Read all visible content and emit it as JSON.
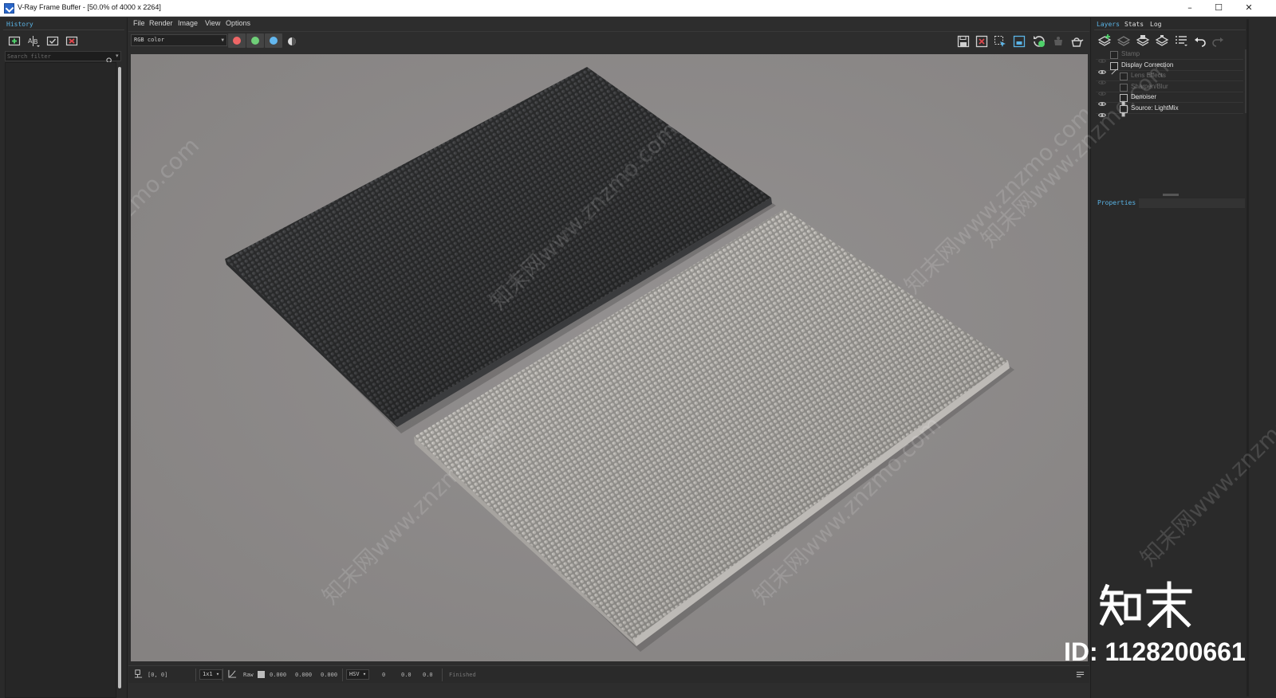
{
  "window": {
    "title": "V-Ray Frame Buffer - [50.0% of 4000 x 2264]",
    "controls": [
      "–",
      "☐",
      "✕"
    ]
  },
  "history": {
    "tab_label": "History",
    "search_placeholder": "Search filter",
    "tool_icons": [
      "save-to-history-icon",
      "ab-compare-icon",
      "load-history-icon",
      "delete-history-icon"
    ]
  },
  "menu": [
    "File",
    "Render",
    "Image",
    "View",
    "Options"
  ],
  "toolbar": {
    "channel": "RGB color",
    "channel_buttons": [
      {
        "name": "red-channel",
        "color": "#ee6666"
      },
      {
        "name": "green-channel",
        "color": "#6fcf78"
      },
      {
        "name": "blue-channel",
        "color": "#63b7ef"
      }
    ],
    "right_icons": [
      "save-image-icon",
      "clear-image-icon",
      "region-render-icon",
      "track-mouse-icon",
      "interactive-render-icon",
      "stop-render-icon",
      "render-teapot-icon"
    ]
  },
  "viewport": {
    "background": "#8e8b89",
    "objects": [
      "dark-bath-mat",
      "light-bath-mat"
    ]
  },
  "statusbar": {
    "coords": "[0, 0]",
    "zoom": "1x1",
    "mode": "Raw",
    "rgb_values": [
      "0.000",
      "0.000",
      "0.000"
    ],
    "color_space": "HSV",
    "hsv_values": [
      "0",
      "0.0",
      "0.0"
    ],
    "status": "Finished"
  },
  "right_panel": {
    "tabs": [
      "Layers",
      "Stats",
      "Log"
    ],
    "active_tab": "Layers",
    "layer_icons": [
      "create-layer-icon",
      "load-layer-icon",
      "save-layers-icon",
      "layer-presets-icon",
      "layer-list-icon",
      "undo-icon",
      "redo-icon"
    ],
    "layers": [
      {
        "label": "Stamp",
        "visible": false,
        "level": 0,
        "dim": true
      },
      {
        "label": "Display Correction",
        "visible": true,
        "level": 0,
        "dim": false
      },
      {
        "label": "Lens Effects",
        "visible": false,
        "level": 1,
        "dim": true
      },
      {
        "label": "Sharpen/Blur",
        "visible": false,
        "level": 1,
        "dim": true
      },
      {
        "label": "Denoiser",
        "visible": true,
        "level": 1,
        "dim": false
      },
      {
        "label": "Source: LightMix",
        "visible": true,
        "level": 1,
        "dim": false
      }
    ],
    "properties_label": "Properties"
  },
  "watermark": {
    "text": "知末网www.znzmo.com",
    "logo_text": "知末",
    "id_text": "ID: 1128200661"
  },
  "colors": {
    "accent": "#5ab4e6",
    "panel": "#2a2a2a",
    "viewport_bg": "#8e8b89"
  }
}
